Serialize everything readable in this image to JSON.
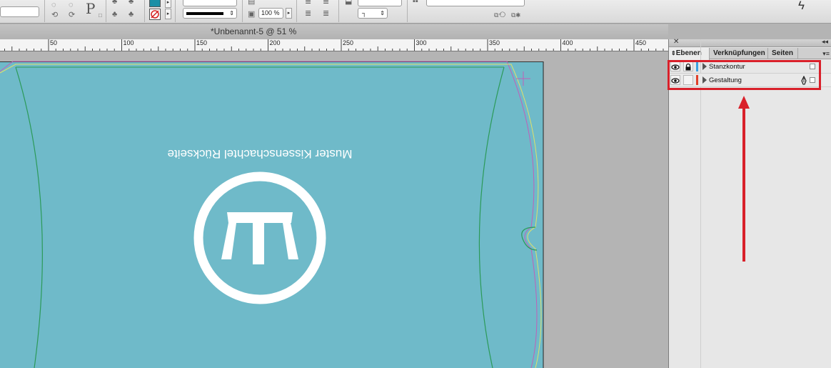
{
  "control_bar": {
    "text_tool_glyph": "P",
    "stroke_weight": "",
    "scale_percent": "100 %",
    "stroke_swatch_color": "#000000",
    "fill_swatch_color": "#1a8fa6"
  },
  "document": {
    "title": "*Unbenannt-5 @ 51 %"
  },
  "ruler": {
    "ticks": [
      "50",
      "100",
      "150",
      "200",
      "250",
      "300",
      "350",
      "400",
      "450"
    ]
  },
  "artwork": {
    "background_color": "#6fbac9",
    "headline": "Muster Kissenschachtel Rückseite",
    "die_line_color": "#2b9a58",
    "bleed_line_color": "#c060b8"
  },
  "panel": {
    "tabs": [
      {
        "label": "Ebenen",
        "active": true
      },
      {
        "label": "Verknüpfungen",
        "active": false
      },
      {
        "label": "Seiten",
        "active": false
      }
    ],
    "layers": [
      {
        "name": "Stanzkontur",
        "color": "#3aa0e0",
        "locked": true,
        "visible": true
      },
      {
        "name": "Gestaltung",
        "color": "#e0402a",
        "locked": false,
        "visible": true
      }
    ]
  },
  "annotation": {
    "color": "#d9202a"
  }
}
